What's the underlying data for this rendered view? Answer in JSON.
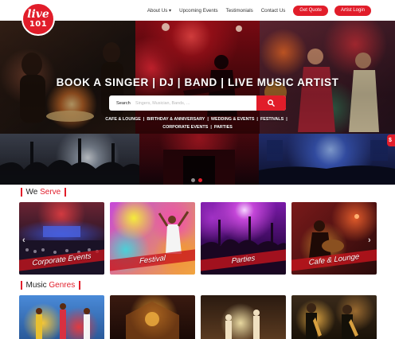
{
  "header": {
    "logo": {
      "line1": "live",
      "line2": "101"
    },
    "nav": [
      {
        "label": "About Us ▾"
      },
      {
        "label": "Upcoming Events"
      },
      {
        "label": "Testimonials"
      },
      {
        "label": "Contact Us"
      }
    ],
    "buttons": {
      "quote": "Get Quote",
      "artist_login": "Artist Login"
    }
  },
  "hero": {
    "title": "BOOK A SINGER | DJ | BAND | LIVE MUSIC ARTIST",
    "search": {
      "label": "Search",
      "placeholder": "Singers, Musician, Bands, ..."
    },
    "categories": [
      "CAFE & LOUNGE",
      "BIRTHDAY & ANNIVERSARY",
      "WEDDING & EVENTS",
      "FESTIVALS",
      "CORPORATE EVENTS",
      "PARTIES"
    ],
    "side_tab": "$"
  },
  "we_serve": {
    "title_part1": "We ",
    "title_part2": "Serve",
    "cards": [
      {
        "label": "Corporate Events"
      },
      {
        "label": "Festival"
      },
      {
        "label": "Parties"
      },
      {
        "label": "Cafe & Lounge"
      }
    ]
  },
  "music_genres": {
    "title_part1": "Music ",
    "title_part2": "Genres"
  },
  "colors": {
    "accent": "#e11d2a"
  }
}
